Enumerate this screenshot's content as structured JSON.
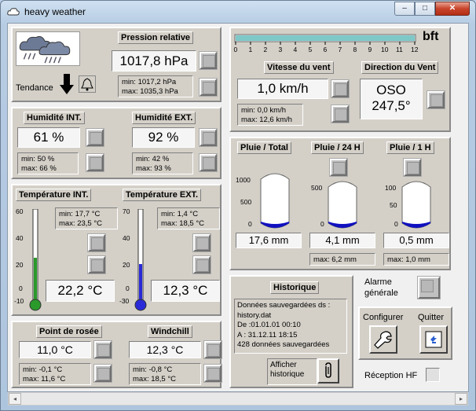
{
  "window": {
    "title": "heavy weather"
  },
  "window_buttons": {
    "minimize": "–",
    "maximize": "□",
    "close": "✕"
  },
  "pressure": {
    "label": "Pression relative",
    "value": "1017,8 hPa",
    "min": "min: 1017,2 hPa",
    "max": "max: 1035,3 hPa",
    "tendency_label": "Tendance",
    "icon": "cloud-rain-icon"
  },
  "wind": {
    "scale_unit": "bft",
    "scale_ticks": [
      "0",
      "1",
      "2",
      "3",
      "4",
      "5",
      "6",
      "7",
      "8",
      "9",
      "10",
      "11",
      "12"
    ],
    "scale_level": 1.0,
    "speed_label": "Vitesse du vent",
    "speed_value": "1,0 km/h",
    "speed_min": "min: 0,0 km/h",
    "speed_max": "max: 12,6 km/h",
    "direction_label": "Direction du Vent",
    "direction_code": "OSO",
    "direction_deg": "247,5°"
  },
  "humidity": {
    "int_label": "Humidité INT.",
    "int_value": "61 %",
    "int_min": "min: 50 %",
    "int_max": "max: 66 %",
    "ext_label": "Humidité EXT.",
    "ext_value": "92 %",
    "ext_min": "min: 42 %",
    "ext_max": "max: 93 %"
  },
  "rain": {
    "total_label": "Pluie / Total",
    "h24_label": "Pluie / 24 H",
    "h1_label": "Pluie / 1 H",
    "total_ticks": [
      "1000",
      "500",
      "0"
    ],
    "h24_ticks": [
      "500",
      "0"
    ],
    "h1_ticks": [
      "100",
      "50",
      "0"
    ],
    "total_value": "17,6 mm",
    "h24_value": "4,1 mm",
    "h1_value": "0,5 mm",
    "h24_max": "max: 6,2 mm",
    "h1_max": "max: 1,0 mm",
    "fill_color": "#1010c0"
  },
  "temperature": {
    "int_label": "Température INT.",
    "int_value": "22,2 °C",
    "int_min": "min: 17,7 °C",
    "int_max": "max: 23,5 °C",
    "int_ticks": [
      "60",
      "40",
      "20",
      "0",
      "-10"
    ],
    "int_color": "#2a9a2a",
    "ext_label": "Température EXT.",
    "ext_value": "12,3 °C",
    "ext_min": "min: 1,4 °C",
    "ext_max": "max: 18,5 °C",
    "ext_ticks": [
      "70",
      "40",
      "20",
      "0",
      "-30"
    ],
    "ext_color": "#2a2ad8"
  },
  "dewpoint": {
    "label": "Point de rosée",
    "value": "11,0 °C",
    "min": "min: -0,1 °C",
    "max": "max: 11,6 °C"
  },
  "windchill": {
    "label": "Windchill",
    "value": "12,3 °C",
    "min": "min: -0,8 °C",
    "max": "max: 18,5 °C"
  },
  "history": {
    "label": "Historique",
    "line1": "Données sauvegardées ds :",
    "line2": "history.dat",
    "line3": "De :01.01.01 00:10",
    "line4": "A : 31.12.11 18:15",
    "line5": "428 données sauvegardées",
    "show_label_1": "Afficher",
    "show_label_2": "historique"
  },
  "alarm": {
    "label_1": "Alarme",
    "label_2": "générale"
  },
  "buttons": {
    "configure": "Configurer",
    "quit": "Quitter"
  },
  "reception": {
    "label": "Réception HF"
  }
}
